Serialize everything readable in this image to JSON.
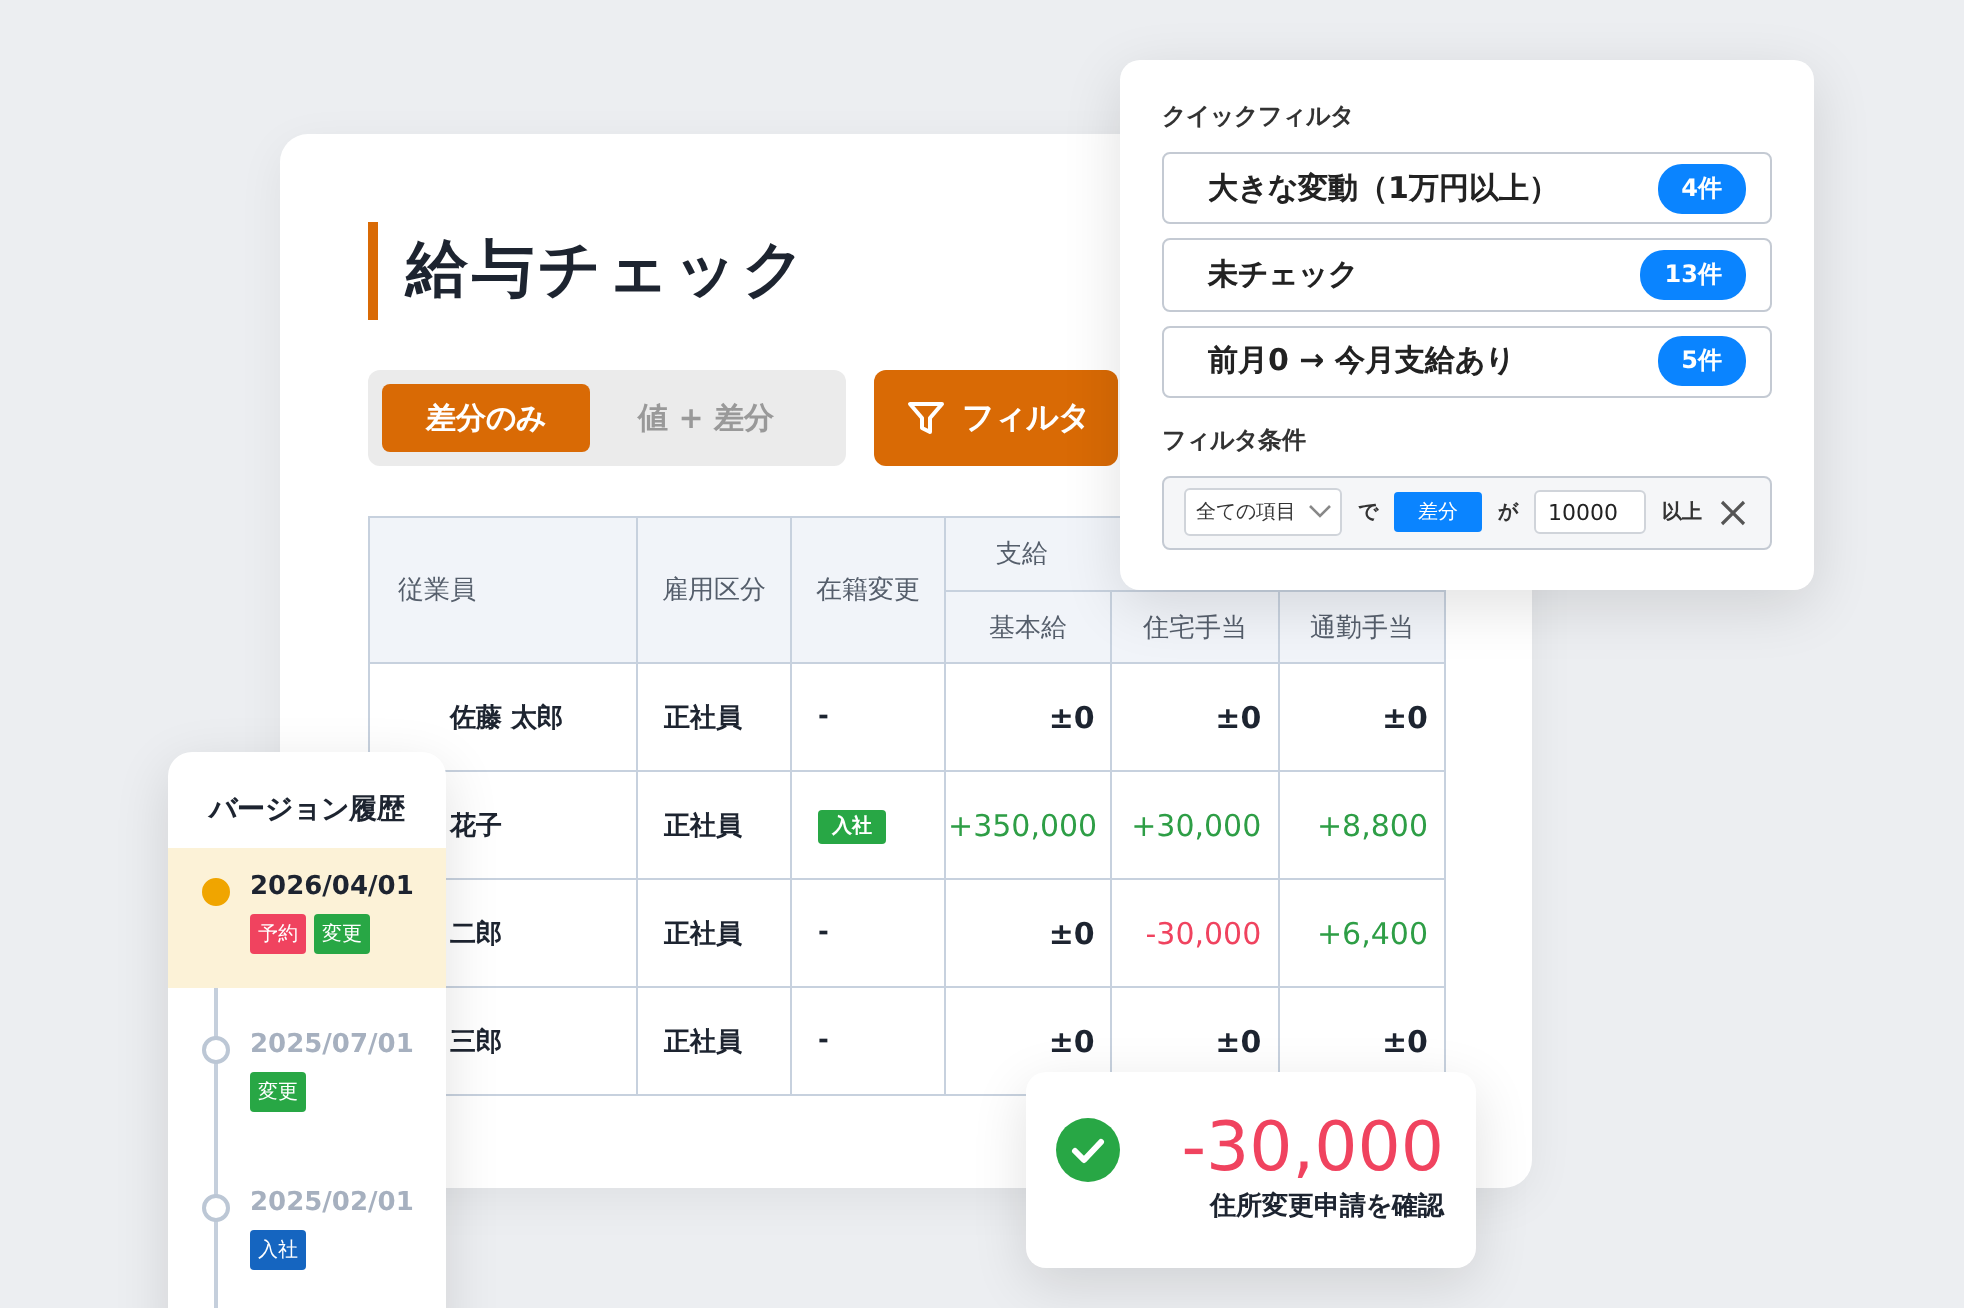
{
  "main": {
    "title": "給与チェック",
    "view_modes": [
      {
        "label": "差分のみ",
        "selected": true
      },
      {
        "label": "値 + 差分",
        "selected": false
      }
    ],
    "filter_button": "フィルタ",
    "table": {
      "columns": [
        "従業員",
        "雇用区分",
        "在籍変更"
      ],
      "group": "支給",
      "subcolumns": [
        "基本給",
        "住宅手当",
        "通勤手当"
      ],
      "rows": [
        {
          "employee": "佐藤 太郎",
          "type": "正社員",
          "status": {
            "text": "-",
            "kind": "plain"
          },
          "amounts": [
            {
              "text": "±0",
              "kind": "none"
            },
            {
              "text": "±0",
              "kind": "none"
            },
            {
              "text": "±0",
              "kind": "none"
            }
          ]
        },
        {
          "employee": "花子",
          "type": "正社員",
          "status": {
            "text": "入社",
            "kind": "tag"
          },
          "amounts": [
            {
              "text": "+350,000",
              "kind": "increase"
            },
            {
              "text": "+30,000",
              "kind": "increase"
            },
            {
              "text": "+8,800",
              "kind": "increase"
            }
          ]
        },
        {
          "employee": "二郎",
          "type": "正社員",
          "status": {
            "text": "-",
            "kind": "plain"
          },
          "amounts": [
            {
              "text": "±0",
              "kind": "none"
            },
            {
              "text": "-30,000",
              "kind": "decrease"
            },
            {
              "text": "+6,400",
              "kind": "increase"
            }
          ]
        },
        {
          "employee": "三郎",
          "type": "正社員",
          "status": {
            "text": "-",
            "kind": "plain"
          },
          "amounts": [
            {
              "text": "±0",
              "kind": "none"
            },
            {
              "text": "±0",
              "kind": "none"
            },
            {
              "text": "±0",
              "kind": "none"
            }
          ]
        }
      ]
    }
  },
  "quick_filter": {
    "title": "クイックフィルタ",
    "items": [
      {
        "label": "大きな変動（1万円以上）",
        "count": "4件"
      },
      {
        "label": "未チェック",
        "count": "13件"
      },
      {
        "label": "前月0 → 今月支給あり",
        "count": "5件"
      }
    ],
    "condition_title": "フィルタ条件",
    "condition": {
      "field": "全ての項目",
      "word_1": "で",
      "mode": "差分",
      "word_2": "が",
      "value": "10000",
      "word_3": "以上"
    }
  },
  "version_history": {
    "title": "バージョン履歴",
    "entries": [
      {
        "date": "2026/04/01",
        "selected": true,
        "tags": [
          {
            "text": "予約",
            "color": "#f0435f"
          },
          {
            "text": "変更",
            "color": "#28a745"
          }
        ]
      },
      {
        "date": "2025/07/01",
        "selected": false,
        "tags": [
          {
            "text": "変更",
            "color": "#28a745"
          }
        ]
      },
      {
        "date": "2025/02/01",
        "selected": false,
        "tags": [
          {
            "text": "入社",
            "color": "#1565c0"
          }
        ]
      }
    ]
  },
  "toast": {
    "amount": "-30,000",
    "message": "住所変更申請を確認"
  }
}
